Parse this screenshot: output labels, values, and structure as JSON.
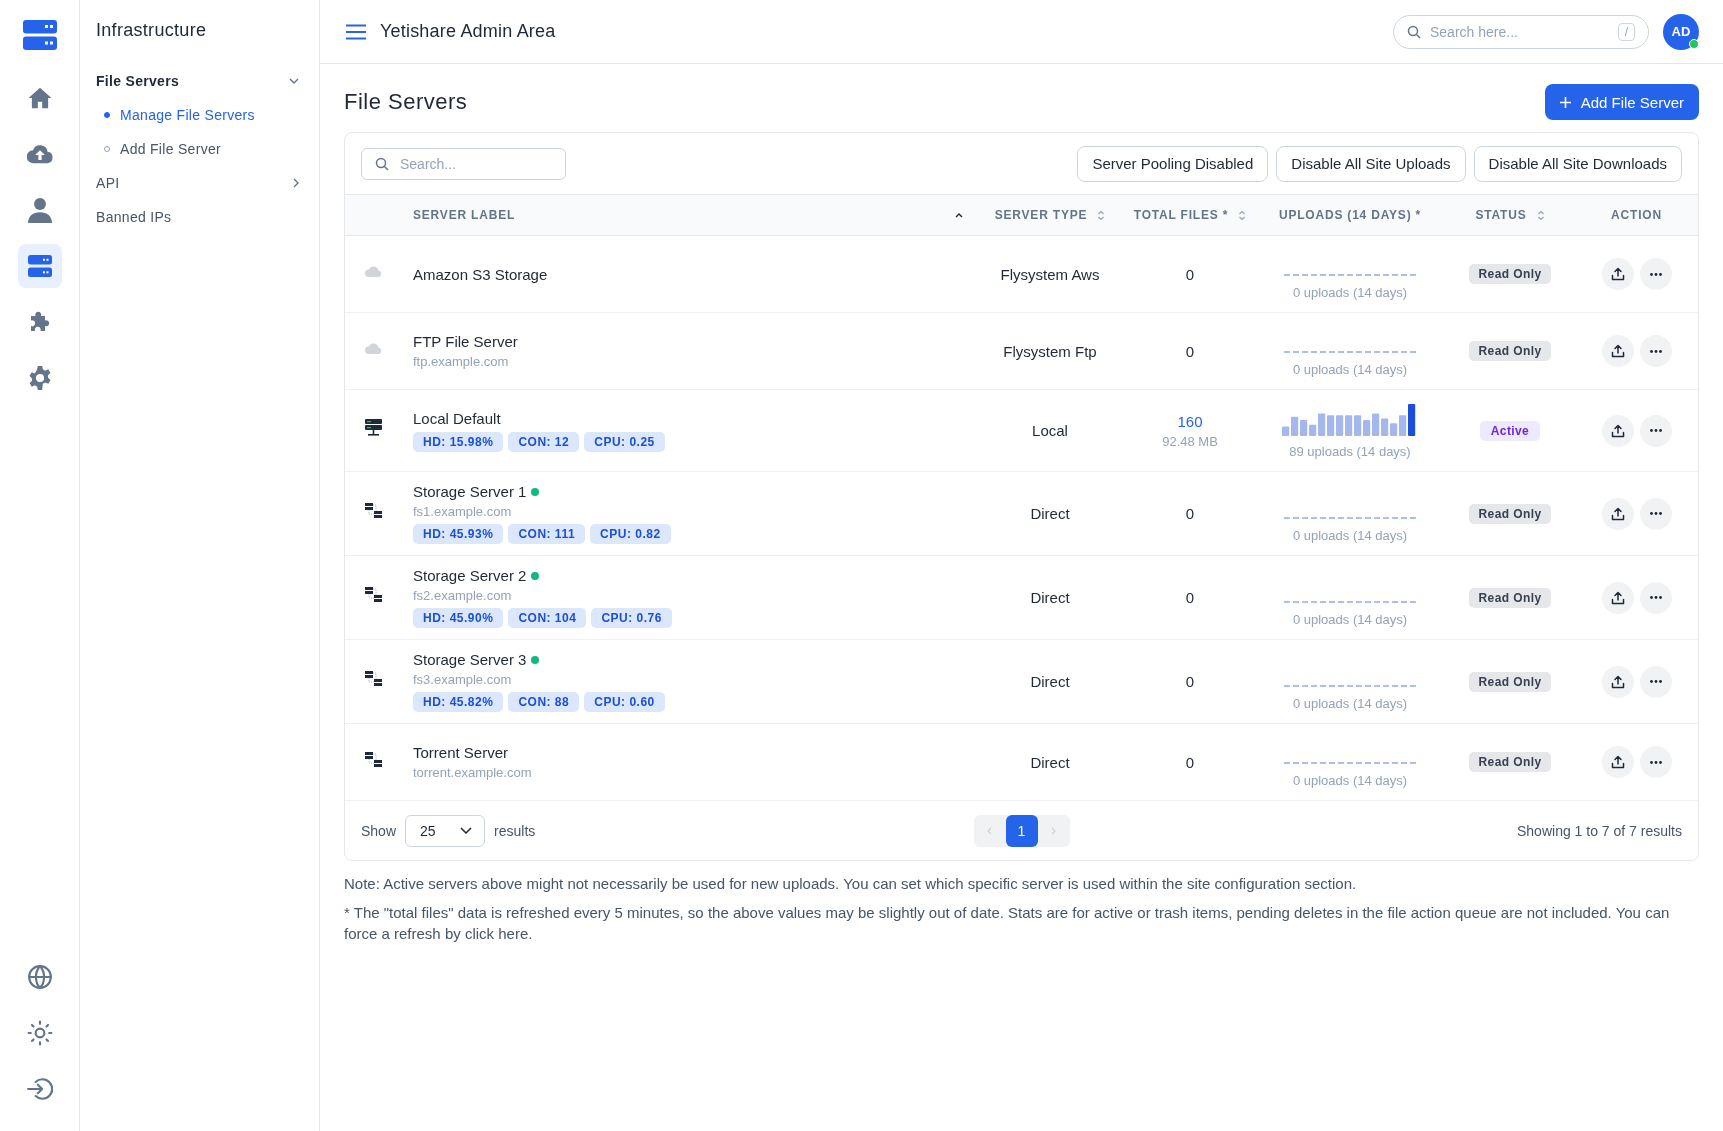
{
  "rail": {
    "top": [
      {
        "kind": "home",
        "selected": false
      },
      {
        "kind": "upload",
        "selected": false
      },
      {
        "kind": "user",
        "selected": false
      },
      {
        "kind": "servers",
        "selected": true
      },
      {
        "kind": "puzzle",
        "selected": false
      },
      {
        "kind": "gear",
        "selected": false
      }
    ],
    "bottom": [
      {
        "kind": "globe",
        "selected": false
      },
      {
        "kind": "sun",
        "selected": false
      },
      {
        "kind": "logout",
        "selected": false
      }
    ]
  },
  "sidebar": {
    "title": "Infrastructure",
    "items": [
      {
        "label": "File Servers",
        "expanded": true,
        "selected": false,
        "children": [
          {
            "label": "Manage File Servers",
            "selected": true
          },
          {
            "label": "Add File Server",
            "selected": false
          }
        ]
      },
      {
        "label": "API",
        "expanded": false,
        "selected": false
      },
      {
        "label": "Banned IPs",
        "selected": false
      }
    ]
  },
  "topbar": {
    "title": "Yetishare Admin Area",
    "search": {
      "placeholder": "Search here...",
      "shortcut": "/"
    },
    "avatar": {
      "initials": "AD",
      "online": true
    }
  },
  "page": {
    "title": "File Servers",
    "add_button": "Add File Server"
  },
  "toolbar": {
    "search": {
      "placeholder": "Search..."
    },
    "buttons": [
      "Server Pooling Disabled",
      "Disable All Site Uploads",
      "Disable All Site Downloads"
    ]
  },
  "table": {
    "columns": [
      {
        "label": "SERVER LABEL",
        "sortable": true,
        "sorted": true
      },
      {
        "label": "SERVER TYPE",
        "sortable": true,
        "sorted": false
      },
      {
        "label": "TOTAL FILES *",
        "sortable": true,
        "sorted": false
      },
      {
        "label": "UPLOADS (14 DAYS) *",
        "sortable": false
      },
      {
        "label": "STATUS",
        "sortable": true,
        "sorted": false
      },
      {
        "label": "ACTION",
        "sortable": false
      }
    ],
    "rows": [
      {
        "kind": "cloud",
        "name": "Amazon S3 Storage",
        "online": false,
        "type": "Flysystem Aws",
        "files": {
          "count": "0",
          "linked": false
        },
        "sparkline": {
          "kind": "flat"
        },
        "uploads": "0 uploads (14 days)",
        "status": {
          "label": "Read Only",
          "kind": "read-only"
        }
      },
      {
        "kind": "cloud",
        "name": "FTP File Server",
        "online": false,
        "host": "ftp.example.com",
        "type": "Flysystem Ftp",
        "files": {
          "count": "0",
          "linked": false
        },
        "sparkline": {
          "kind": "flat"
        },
        "uploads": "0 uploads (14 days)",
        "status": {
          "label": "Read Only",
          "kind": "read-only"
        }
      },
      {
        "kind": "local",
        "name": "Local Default",
        "online": false,
        "stats": [
          "HD: 15.98%",
          "CON: 12",
          "CPU: 0.25"
        ],
        "type": "Local",
        "files": {
          "count": "160",
          "size": "92.48 MB",
          "linked": true
        },
        "sparkline": {
          "kind": "bars"
        },
        "uploads": "89 uploads (14 days)",
        "status": {
          "label": "Active",
          "kind": "active"
        }
      },
      {
        "kind": "direct",
        "name": "Storage Server 1",
        "online": true,
        "host": "fs1.example.com",
        "stats": [
          "HD: 45.93%",
          "CON: 111",
          "CPU: 0.82"
        ],
        "type": "Direct",
        "files": {
          "count": "0",
          "linked": false
        },
        "sparkline": {
          "kind": "flat"
        },
        "uploads": "0 uploads (14 days)",
        "status": {
          "label": "Read Only",
          "kind": "read-only"
        }
      },
      {
        "kind": "direct",
        "name": "Storage Server 2",
        "online": true,
        "host": "fs2.example.com",
        "stats": [
          "HD: 45.90%",
          "CON: 104",
          "CPU: 0.76"
        ],
        "type": "Direct",
        "files": {
          "count": "0",
          "linked": false
        },
        "sparkline": {
          "kind": "flat"
        },
        "uploads": "0 uploads (14 days)",
        "status": {
          "label": "Read Only",
          "kind": "read-only"
        }
      },
      {
        "kind": "direct",
        "name": "Storage Server 3",
        "online": true,
        "host": "fs3.example.com",
        "stats": [
          "HD: 45.82%",
          "CON: 88",
          "CPU: 0.60"
        ],
        "type": "Direct",
        "files": {
          "count": "0",
          "linked": false
        },
        "sparkline": {
          "kind": "flat"
        },
        "uploads": "0 uploads (14 days)",
        "status": {
          "label": "Read Only",
          "kind": "read-only"
        }
      },
      {
        "kind": "direct",
        "name": "Torrent Server",
        "online": false,
        "host": "torrent.example.com",
        "type": "Direct",
        "files": {
          "count": "0",
          "linked": false
        },
        "sparkline": {
          "kind": "flat"
        },
        "uploads": "0 uploads (14 days)",
        "status": {
          "label": "Read Only",
          "kind": "read-only"
        }
      }
    ]
  },
  "footer": {
    "show_label": "Show",
    "page_size": "25",
    "results_label": "results",
    "pages": [
      {
        "label": "1",
        "selected": true
      }
    ],
    "summary": "Showing 1 to 7 of 7 results"
  },
  "notes": [
    "Note: Active servers above might not necessarily be used for new uploads. You can set which specific server is used within the site configuration section.",
    "* The \"total files\" data is refreshed every 5 minutes, so the above values may be slightly out of date. Stats are for active or trash items, pending deletes in the file action queue are not included. You can force a refresh by click here."
  ]
}
